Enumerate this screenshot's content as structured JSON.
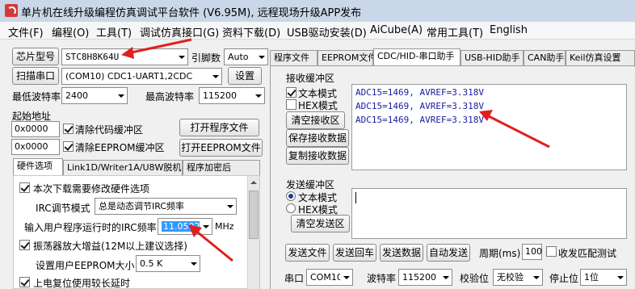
{
  "window": {
    "title": "单片机在线升级编程仿真调试平台软件 (V6.95M), 远程现场升级APP发布"
  },
  "menu": [
    "文件(F)",
    "编程(O)",
    "工具(T)",
    "调试仿真接口(G)",
    "资料下载(D)",
    "USB驱动安装(D)",
    "AiCube(A)",
    "常用工具(T)",
    "English"
  ],
  "left": {
    "chip_label": "芯片型号",
    "chip_value": "STC8H8K64U",
    "pins_label": "引脚数",
    "pins_value": "Auto",
    "scan_label": "扫描串口",
    "port_value": "(COM10) CDC1-UART1,2CDC",
    "settings_label": "设置",
    "min_baud_label": "最低波特率",
    "min_baud_value": "2400",
    "max_baud_label": "最高波特率",
    "max_baud_value": "115200",
    "start_addr_label": "起始地址",
    "addr1": "0x0000",
    "clear_code_label": "清除代码缓冲区",
    "open_program_label": "打开程序文件",
    "addr2": "0x0000",
    "clear_eeprom_label": "清除EEPROM缓冲区",
    "open_eeprom_label": "打开EEPROM文件",
    "tabs": [
      "硬件选项",
      "Link1D/Writer1A/U8W脱机",
      "程序加密后"
    ],
    "opt_modify_hw": "本次下载需要修改硬件选项",
    "irc_mode_label": "IRC调节模式",
    "irc_mode_value": "总是动态调节IRC频率",
    "irc_freq_label": "输入用户程序运行时的IRC频率",
    "irc_freq_value": "11.0592",
    "irc_freq_unit": "MHz",
    "opt_osc_gain": "振荡器放大增益(12M以上建议选择)",
    "eeprom_size_label": "设置用户EEPROM大小",
    "eeprom_size_value": "0.5 K",
    "opt_long_reset": "上电复位使用较长延时"
  },
  "right": {
    "tabs": [
      "程序文件",
      "EEPROM文件",
      "CDC/HID-串口助手",
      "USB-HID助手",
      "CAN助手",
      "Keil仿真设置"
    ],
    "recv_title": "接收缓冲区",
    "recv_text_mode": "文本模式",
    "recv_hex_mode": "HEX模式",
    "clear_recv": "清空接收区",
    "save_recv": "保存接收数据",
    "copy_recv": "复制接收数据",
    "recv_lines": [
      "ADC15=1469,  AVREF=3.318V",
      "ADC15=1469,  AVREF=3.318V",
      "ADC15=1469,  AVREF=3.318V"
    ],
    "send_title": "发送缓冲区",
    "send_text_mode": "文本模式",
    "send_hex_mode": "HEX模式",
    "clear_send": "清空发送区",
    "send_file": "发送文件",
    "send_crlf": "发送回车",
    "send_data": "发送数据",
    "auto_send": "自动发送",
    "period_label": "周期(ms)",
    "period_value": "100",
    "match_label": "收发匹配测试",
    "port_label": "串口",
    "port_value": "COM10",
    "baud_label": "波特率",
    "baud_value": "115200",
    "parity_label": "校验位",
    "parity_value": "无校验",
    "stop_label": "停止位",
    "stop_value": "1位"
  },
  "colors": {
    "annotation_arrow": "#e02020",
    "recv_text": "#1a1aa0",
    "highlight": "#3399ff"
  }
}
